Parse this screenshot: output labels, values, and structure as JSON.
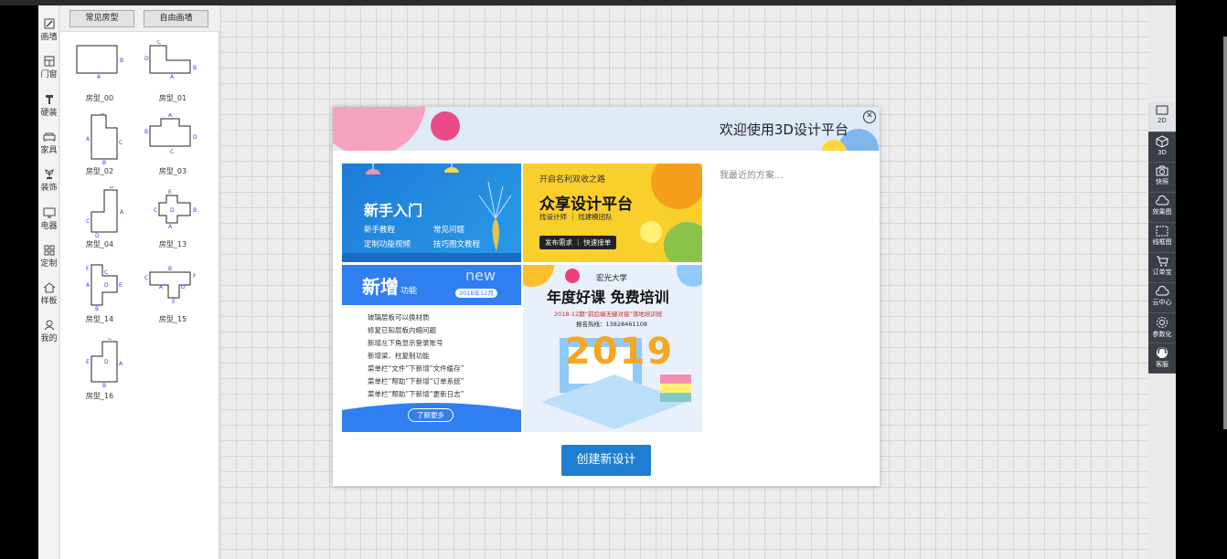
{
  "left_toolbar": {
    "items": [
      {
        "label": "画墙",
        "icon": "pencil-icon"
      },
      {
        "label": "门窗",
        "icon": "window-icon"
      },
      {
        "label": "硬装",
        "icon": "paint-roller-icon"
      },
      {
        "label": "家具",
        "icon": "sofa-icon"
      },
      {
        "label": "装饰",
        "icon": "plant-icon"
      },
      {
        "label": "电器",
        "icon": "monitor-icon"
      },
      {
        "label": "定制",
        "icon": "grid-icon"
      },
      {
        "label": "样板",
        "icon": "house-icon"
      },
      {
        "label": "我的",
        "icon": "user-icon"
      }
    ]
  },
  "room_panel": {
    "tab_common": "常见房型",
    "tab_free": "自由画墙",
    "rooms": [
      {
        "label": "房型_00"
      },
      {
        "label": "房型_01"
      },
      {
        "label": "房型_02"
      },
      {
        "label": "房型_03"
      },
      {
        "label": "房型_04"
      },
      {
        "label": "房型_13"
      },
      {
        "label": "房型_14"
      },
      {
        "label": "房型_15"
      },
      {
        "label": "房型_16"
      }
    ]
  },
  "right_toolbar": {
    "items": [
      {
        "label": "2D",
        "icon": "2d-view-icon"
      },
      {
        "label": "3D",
        "icon": "3d-cube-icon"
      },
      {
        "label": "快照",
        "icon": "camera-icon"
      },
      {
        "label": "效果图",
        "icon": "cloud-render-icon"
      },
      {
        "label": "线框图",
        "icon": "wireframe-icon"
      },
      {
        "label": "订单宝",
        "icon": "cart-icon"
      },
      {
        "label": "云中心",
        "icon": "cloud-icon"
      },
      {
        "label": "参数化",
        "icon": "settings-icon"
      },
      {
        "label": "客服",
        "icon": "headset-icon"
      }
    ]
  },
  "modal": {
    "title": "欢迎使用3D设计平台",
    "recent_label": "我最近的方案...",
    "create_button": "创建新设计",
    "card1": {
      "title": "新手入门",
      "links": [
        "新手教程",
        "常见问题",
        "定制功能视频",
        "技巧图文教程"
      ]
    },
    "card2": {
      "top": "开启名利双收之路",
      "title": "众享设计平台",
      "subtitle": "找设计师 ｜ 找建模团队",
      "pill": "发布需求 ｜ 快速接单"
    },
    "card3": {
      "title": "新增",
      "title_suffix": "功能",
      "new_tag": "new",
      "date": "2018年12月",
      "items": [
        "玻璃层板可以换材质",
        "修复已知层板内缩问题",
        "新增左下角显示登录账号",
        "新增梁、柱复制功能",
        "菜单栏“文件”下新增“文件缓存”",
        "菜单栏“帮助”下新增“订单系统”",
        "菜单栏“帮助”下新增“更新日志”"
      ],
      "more": "了解更多"
    },
    "card4": {
      "school": "宏光大学",
      "title": "年度好课 免费培训",
      "line1": "2018-12期“前后端无缝对接”落地培训班",
      "line2": "报名热线：13828461108",
      "year": "2019"
    }
  }
}
